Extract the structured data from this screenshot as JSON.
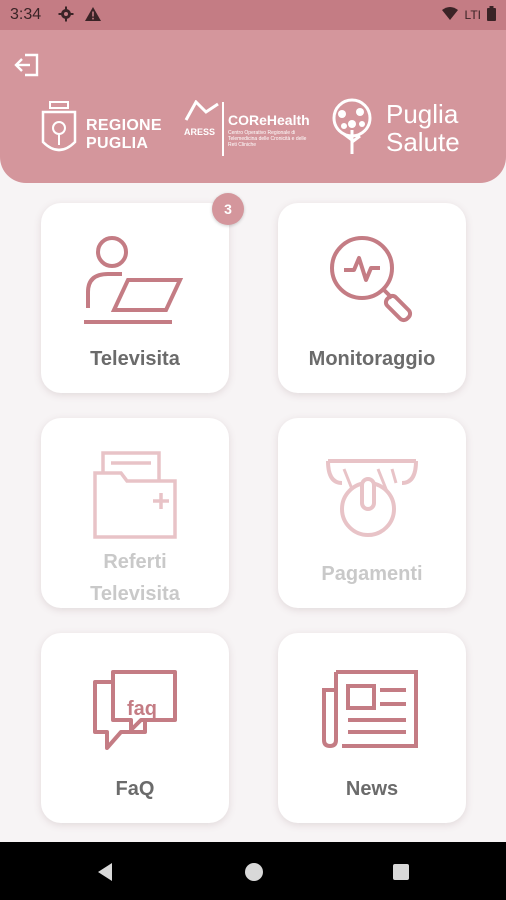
{
  "status_bar": {
    "time": "3:34",
    "network": "LTI"
  },
  "header": {
    "logos": {
      "regione_line1": "REGIONE",
      "regione_line2": "PUGLIA",
      "aress": "ARESS",
      "corehealth": "COReHealth",
      "corehealth_sub": "Centro Operativo Regionale di Telemedicina delle Cronicità e delle Reti Cliniche",
      "puglia_salute_line1": "Puglia",
      "puglia_salute_line2": "Salute"
    }
  },
  "menu": {
    "televisita": {
      "label": "Televisita",
      "badge": "3"
    },
    "monitoraggio": {
      "label": "Monitoraggio"
    },
    "referti": {
      "label_line1": "Referti",
      "label_line2": "Televisita"
    },
    "pagamenti": {
      "label": "Pagamenti"
    },
    "faq": {
      "label": "FaQ",
      "icon_text": "faq"
    },
    "news": {
      "label": "News"
    }
  },
  "colors": {
    "primary": "#d4969c",
    "status_bar": "#c47c84",
    "icon": "#c47c84",
    "icon_disabled": "#e8c3c7",
    "label": "#6b6b6b",
    "label_disabled": "#c9c9c9"
  }
}
